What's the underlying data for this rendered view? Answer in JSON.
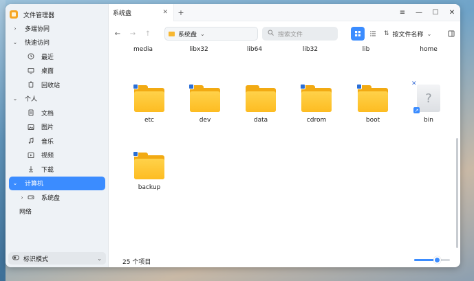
{
  "app": {
    "title": "文件管理器"
  },
  "sidebar": {
    "groups": [
      {
        "label": "多端协同",
        "chevron": "right"
      },
      {
        "label": "快速访问",
        "chevron": "down"
      },
      {
        "label": "个人",
        "chevron": "down"
      },
      {
        "label": "计算机",
        "chevron": "down"
      },
      {
        "label": "网络"
      }
    ],
    "quick_items": [
      {
        "label": "最近",
        "icon": "clock-icon"
      },
      {
        "label": "桌面",
        "icon": "desktop-icon"
      },
      {
        "label": "回收站",
        "icon": "trash-icon"
      }
    ],
    "personal_items": [
      {
        "label": "文档",
        "icon": "document-icon"
      },
      {
        "label": "图片",
        "icon": "image-icon"
      },
      {
        "label": "音乐",
        "icon": "music-icon"
      },
      {
        "label": "视频",
        "icon": "video-icon"
      },
      {
        "label": "下载",
        "icon": "download-icon"
      }
    ],
    "computer_items": [
      {
        "label": "系统盘",
        "icon": "disk-icon"
      }
    ],
    "mode": {
      "label": "标识模式"
    }
  },
  "tabs": [
    {
      "label": "系统盘"
    }
  ],
  "toolbar": {
    "path": "系统盘",
    "search_placeholder": "搜索文件",
    "sort_label": "按文件名称"
  },
  "files_top": [
    "media",
    "libx32",
    "lib64",
    "lib32",
    "lib",
    "home"
  ],
  "files": [
    {
      "name": "etc",
      "type": "folder",
      "locked": true
    },
    {
      "name": "dev",
      "type": "folder",
      "locked": true
    },
    {
      "name": "data",
      "type": "folder",
      "locked": false
    },
    {
      "name": "cdrom",
      "type": "folder",
      "locked": true
    },
    {
      "name": "boot",
      "type": "folder",
      "locked": true
    },
    {
      "name": "bin",
      "type": "unknown-link",
      "locked": false
    },
    {
      "name": "backup",
      "type": "folder",
      "locked": true
    }
  ],
  "status": {
    "text": "25 个项目"
  },
  "zoom": {
    "value": 0.65
  },
  "colors": {
    "accent": "#3b8cff",
    "folder": "#fdbc22"
  }
}
